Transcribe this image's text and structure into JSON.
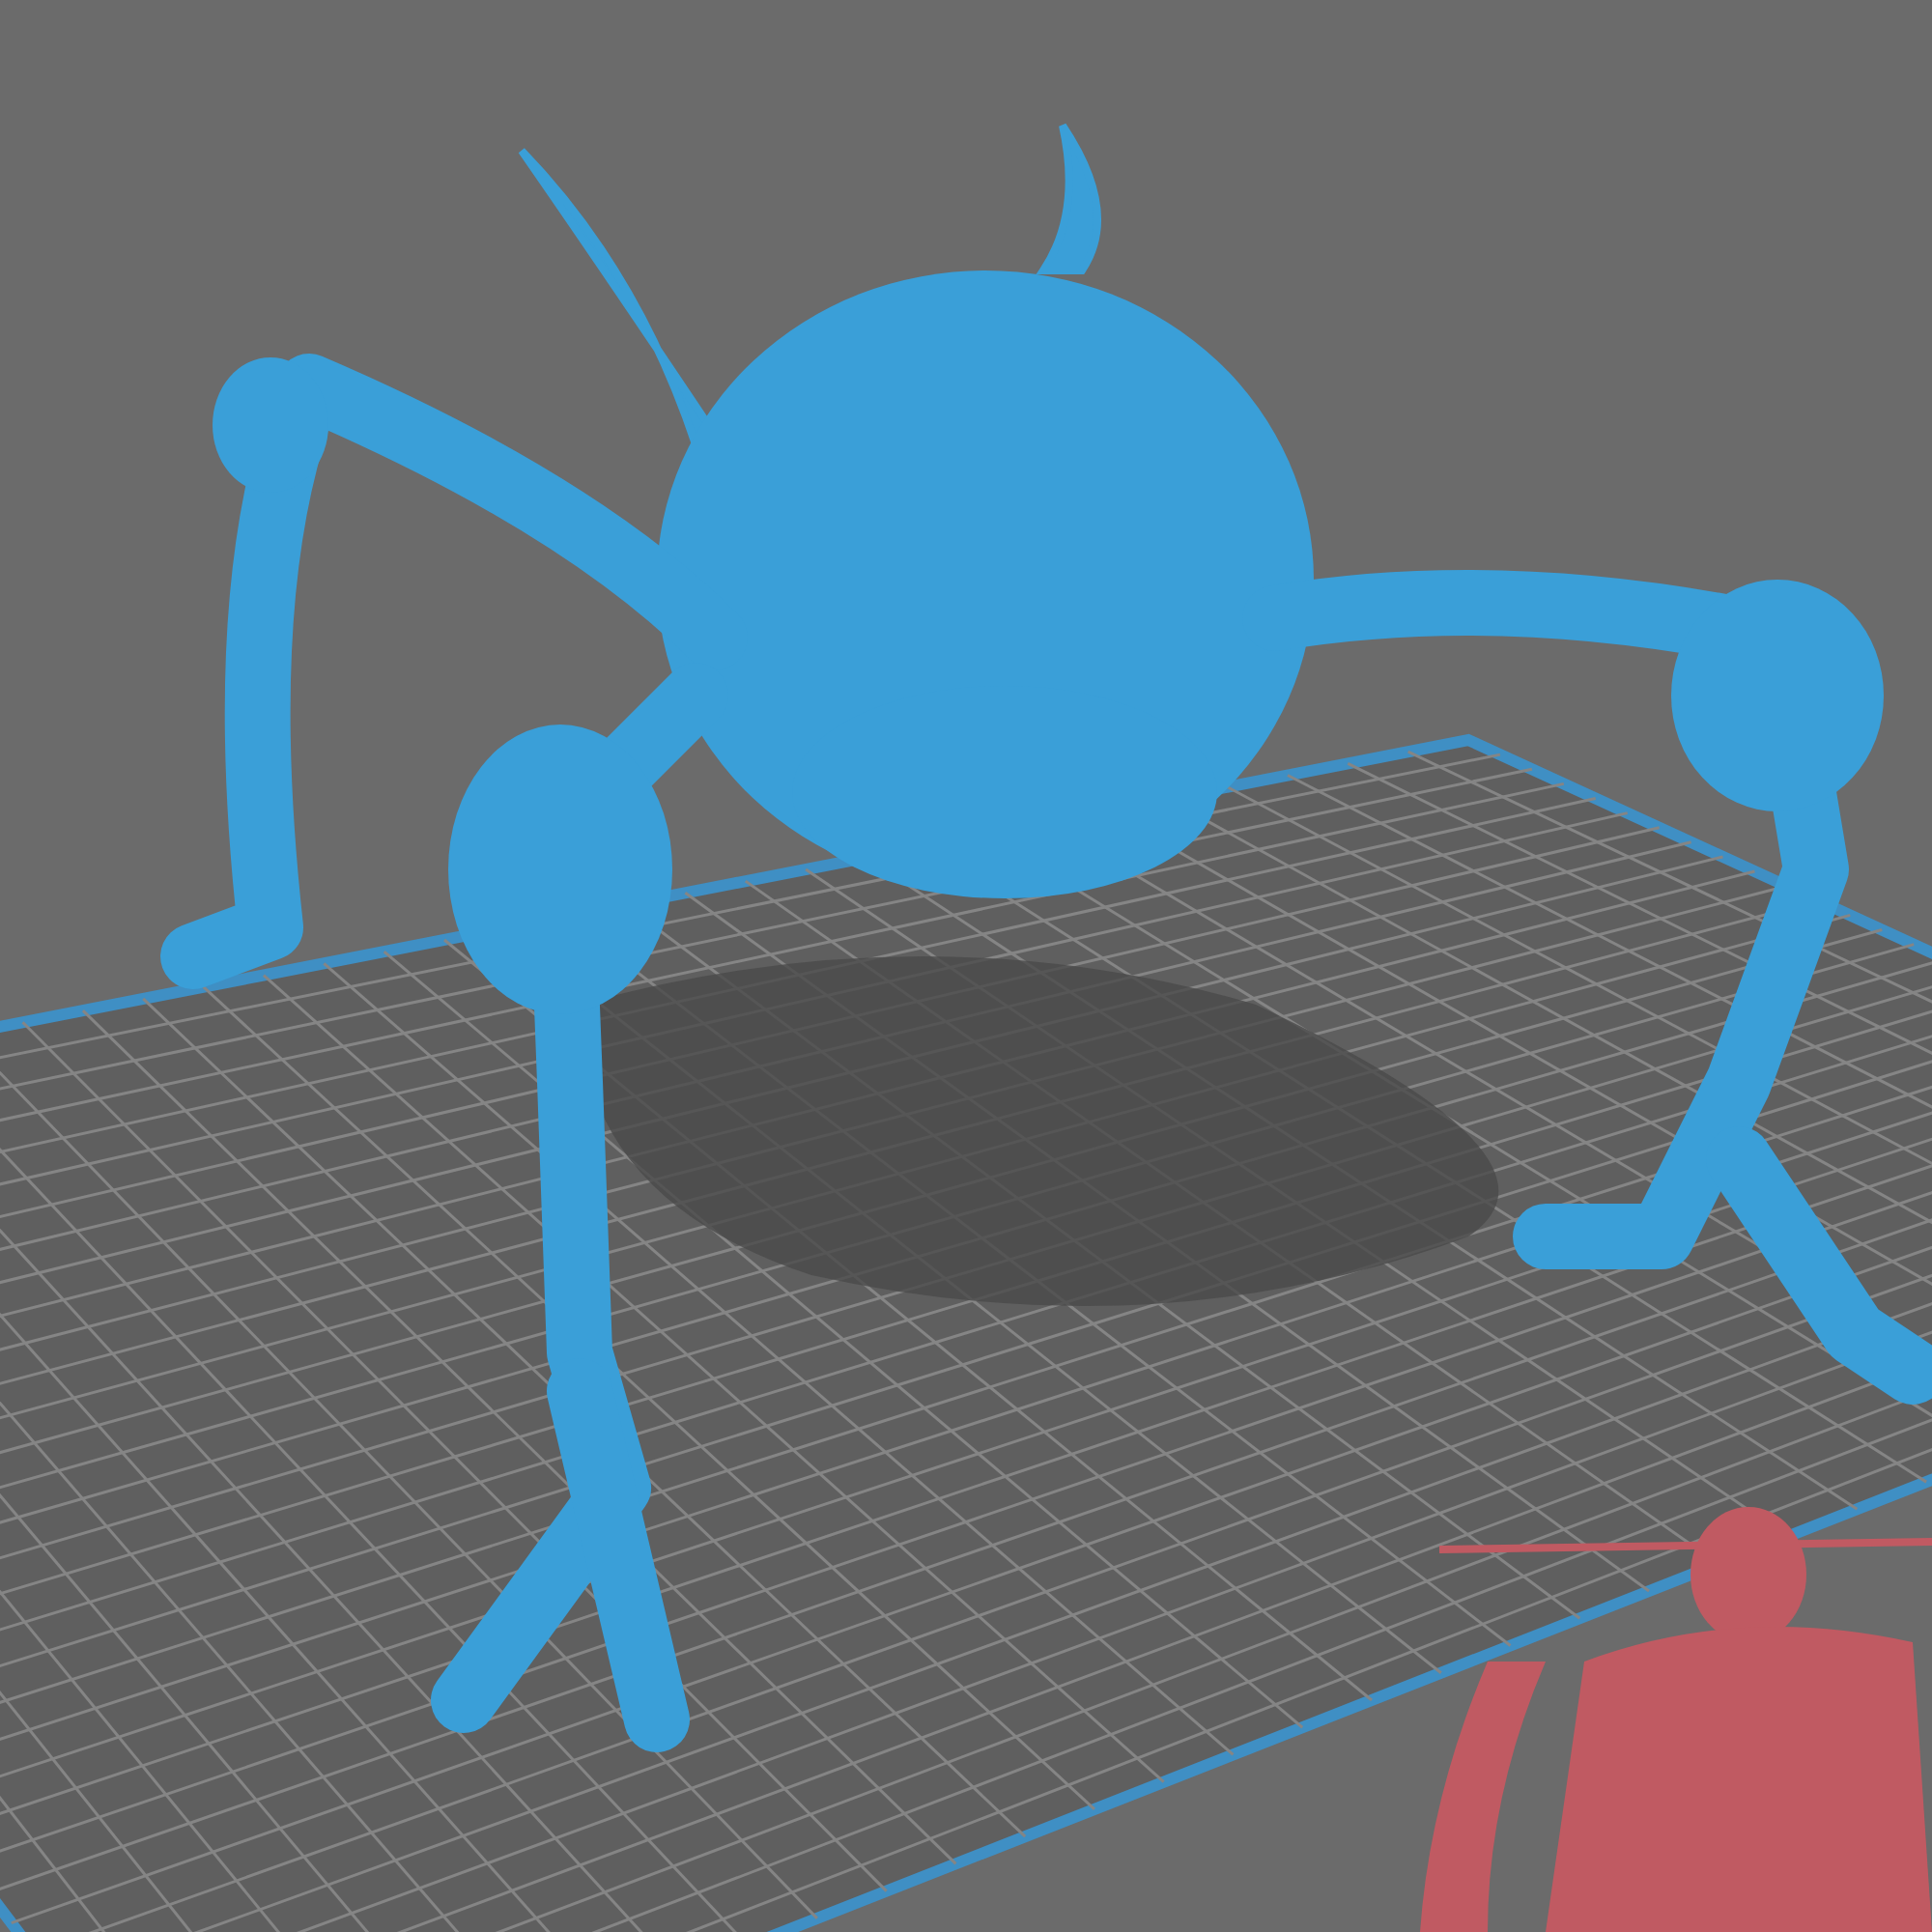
{
  "viewport": {
    "models": [
      {
        "kind": "creature",
        "color": "#3a9fd8"
      },
      {
        "kind": "knight",
        "color": "#c05a62"
      }
    ]
  }
}
